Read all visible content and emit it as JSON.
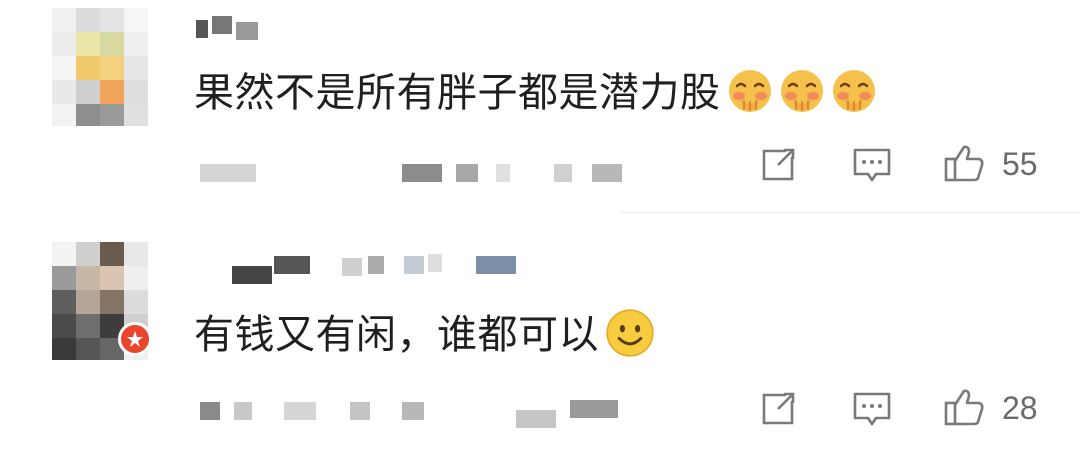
{
  "comments": [
    {
      "text": "果然不是所有胖子都是潜力股",
      "emoji": "shy-blush-emoji",
      "emoji_count": 3,
      "likes": "55"
    },
    {
      "text": "有钱又有闲，谁都可以",
      "emoji": "smile-emoji",
      "emoji_count": 1,
      "likes": "28"
    }
  ],
  "icons": {
    "share": "share-icon",
    "reply": "comment-icon",
    "like": "thumbs-up-icon"
  },
  "colors": {
    "text": "#1f1f1f",
    "meta": "#6a6a6a",
    "icon": "#7a7a7a",
    "divider": "#ededed",
    "emoji_face": "#f6c14a",
    "emoji_blush": "#ef7b62"
  }
}
